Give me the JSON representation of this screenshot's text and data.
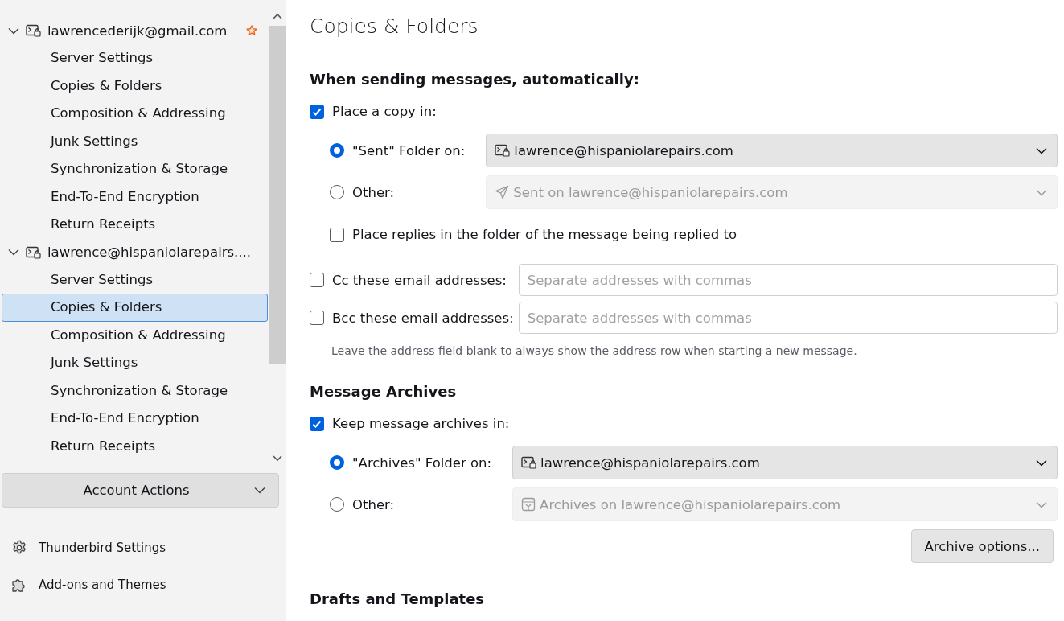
{
  "sidebar": {
    "accounts": [
      {
        "name": "lawrencederijk@gmail.com",
        "expanded": true,
        "default": true,
        "children": [
          {
            "label": "Server Settings",
            "selected": false
          },
          {
            "label": "Copies & Folders",
            "selected": false
          },
          {
            "label": "Composition & Addressing",
            "selected": false
          },
          {
            "label": "Junk Settings",
            "selected": false
          },
          {
            "label": "Synchronization & Storage",
            "selected": false
          },
          {
            "label": "End-To-End Encryption",
            "selected": false
          },
          {
            "label": "Return Receipts",
            "selected": false
          }
        ]
      },
      {
        "name": "lawrence@hispaniolarepairs....",
        "expanded": true,
        "default": false,
        "children": [
          {
            "label": "Server Settings",
            "selected": false
          },
          {
            "label": "Copies & Folders",
            "selected": true
          },
          {
            "label": "Composition & Addressing",
            "selected": false
          },
          {
            "label": "Junk Settings",
            "selected": false
          },
          {
            "label": "Synchronization & Storage",
            "selected": false
          },
          {
            "label": "End-To-End Encryption",
            "selected": false
          },
          {
            "label": "Return Receipts",
            "selected": false
          }
        ]
      }
    ],
    "account_actions": "Account Actions",
    "footer_links": [
      {
        "label": "Thunderbird Settings",
        "kind": "settings"
      },
      {
        "label": "Add-ons and Themes",
        "kind": "addons"
      }
    ]
  },
  "page": {
    "title": "Copies & Folders",
    "sending": {
      "heading": "When sending messages, automatically:",
      "place_copy": {
        "label": "Place a copy in:",
        "checked": true
      },
      "folder_options": [
        {
          "label": "\"Sent\" Folder on:",
          "selected": true,
          "value": "lawrence@hispaniolarepairs.com",
          "kind": "account",
          "disabled": false
        },
        {
          "label": "Other:",
          "selected": false,
          "value": "Sent on lawrence@hispaniolarepairs.com",
          "kind": "sent",
          "disabled": true
        }
      ],
      "replies": {
        "label": "Place replies in the folder of the message being replied to",
        "checked": false
      },
      "address_fields": [
        {
          "label": "Cc these email addresses:",
          "checked": false,
          "placeholder": "Separate addresses with commas"
        },
        {
          "label": "Bcc these email addresses:",
          "checked": false,
          "placeholder": "Separate addresses with commas"
        }
      ],
      "hint": "Leave the address field blank to always show the address row when starting a new message."
    },
    "archives": {
      "heading": "Message Archives",
      "keep": {
        "label": "Keep message archives in:",
        "checked": true
      },
      "folder_options": [
        {
          "label": "\"Archives\" Folder on:",
          "selected": true,
          "value": "lawrence@hispaniolarepairs.com",
          "kind": "account",
          "disabled": false
        },
        {
          "label": "Other:",
          "selected": false,
          "value": "Archives on lawrence@hispaniolarepairs.com",
          "kind": "archive",
          "disabled": true
        }
      ],
      "button": "Archive options..."
    },
    "drafts": {
      "heading": "Drafts and Templates"
    }
  }
}
